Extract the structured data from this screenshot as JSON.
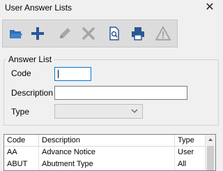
{
  "window": {
    "title": "User Answer Lists",
    "close_glyph": "✕"
  },
  "toolbar": {
    "buttons": [
      {
        "name": "open-folder-icon",
        "enabled": true
      },
      {
        "name": "add-icon",
        "enabled": true
      },
      {
        "name": "edit-pencil-icon",
        "enabled": false
      },
      {
        "name": "delete-x-icon",
        "enabled": false
      },
      {
        "name": "preview-document-icon",
        "enabled": true
      },
      {
        "name": "print-icon",
        "enabled": true
      },
      {
        "name": "warning-icon",
        "enabled": false
      }
    ]
  },
  "form": {
    "group_title": "Answer List",
    "code_label": "Code",
    "code_value": "",
    "description_label": "Description",
    "description_value": "",
    "type_label": "Type",
    "type_value": ""
  },
  "grid": {
    "columns": [
      "Code",
      "Description",
      "Type"
    ],
    "rows": [
      {
        "code": "AA",
        "description": "Advance Notice",
        "type": "User"
      },
      {
        "code": "ABUT",
        "description": "Abutment Type",
        "type": "All"
      }
    ]
  },
  "colors": {
    "focus_border": "#0078d7",
    "icon_enabled": "#2b5797",
    "icon_disabled": "#a6a6a6",
    "folder_icon": "#2f6fb5"
  }
}
